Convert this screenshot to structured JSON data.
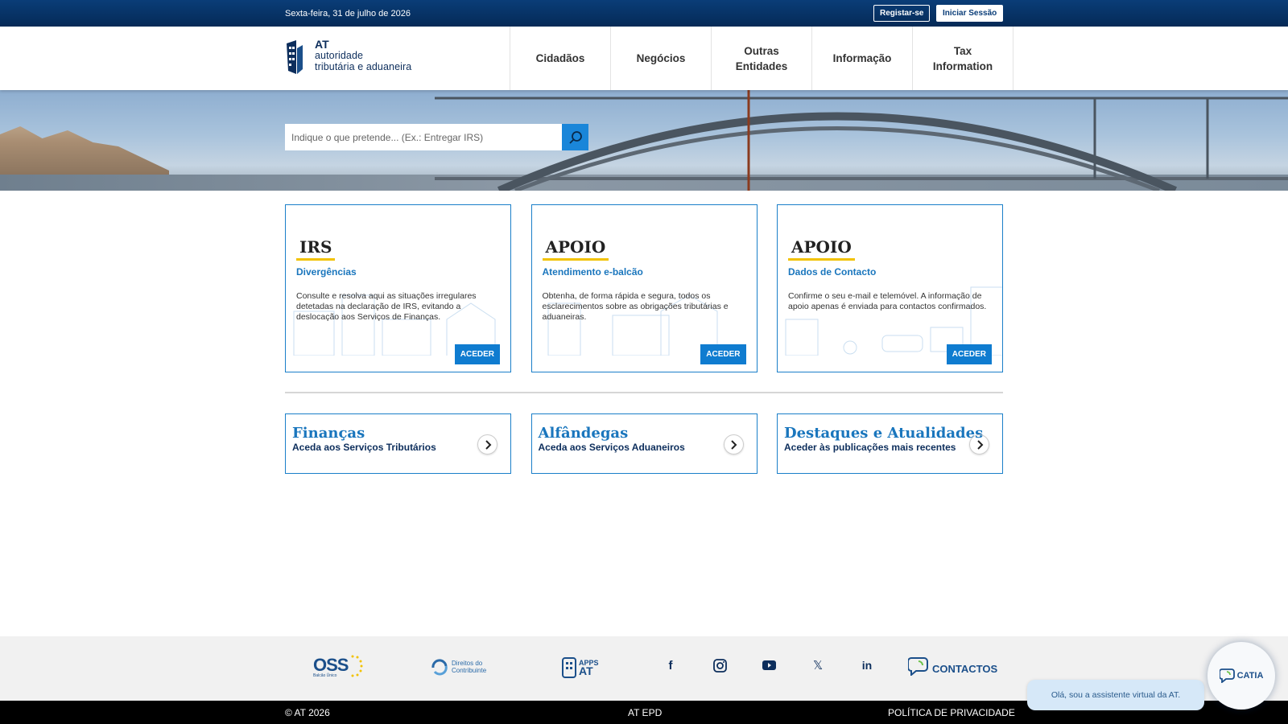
{
  "topbar": {
    "date": "Sexta-feira, 31 de julho de 2026",
    "register_label": "Registar-se",
    "login_label": "Iniciar Sessão"
  },
  "brand": {
    "line1": "AT",
    "line2": "autoridade",
    "line3": "tributária e aduaneira",
    "color": "#0d2e5c"
  },
  "nav": {
    "items": [
      {
        "label": "Cidadãos"
      },
      {
        "label": "Negócios"
      },
      {
        "label": "Outras Entidades"
      },
      {
        "label": "Informação"
      },
      {
        "label": "Tax Information"
      }
    ]
  },
  "search": {
    "placeholder": "Indique o que pretende... (Ex.: Entregar IRS)",
    "icon": "search-icon"
  },
  "cards": [
    {
      "title": "IRS",
      "subtitle": "Divergências",
      "description": "Consulte e resolva aqui as situações irregulares detetadas na declaração de IRS, evitando a deslocação aos Serviços de Finanças.",
      "button": "ACEDER"
    },
    {
      "title": "APOIO",
      "subtitle": "Atendimento e-balcão",
      "description": "Obtenha, de forma rápida e segura, todos os esclarecimentos sobre as obrigações tributárias e aduaneiras.",
      "button": "ACEDER"
    },
    {
      "title": "APOIO",
      "subtitle": "Dados de Contacto",
      "description": "Confirme o seu e-mail e telemóvel. A informação de apoio apenas é enviada para contactos confirmados.",
      "button": "ACEDER"
    }
  ],
  "links": [
    {
      "title": "Finanças",
      "subtitle": "Aceda aos Serviços Tributários"
    },
    {
      "title": "Alfândegas",
      "subtitle": "Aceda aos Serviços Aduaneiros"
    },
    {
      "title": "Destaques e Atualidades",
      "subtitle": "Aceder às publicações mais recentes"
    }
  ],
  "footer": {
    "oss": "OSS",
    "oss_sub": "Balcão Único",
    "direitos_line1": "Direitos do",
    "direitos_line2": "Contribuinte",
    "apps_line1": "APPS",
    "apps_line2": "AT",
    "social": {
      "facebook": "f",
      "x": "𝕏",
      "linkedin": "in"
    },
    "contacts": "CONTACTOS"
  },
  "bottombar": {
    "copyright": "© AT 2026",
    "epd": "AT EPD",
    "privacy": "POLÍTICA DE PRIVACIDADE"
  },
  "chat": {
    "message": "Olá, sou a assistente virtual da AT.",
    "name": "CATIA"
  },
  "colors": {
    "primary": "#0a3d78",
    "accent": "#1a86d9",
    "highlight": "#f2c200"
  }
}
